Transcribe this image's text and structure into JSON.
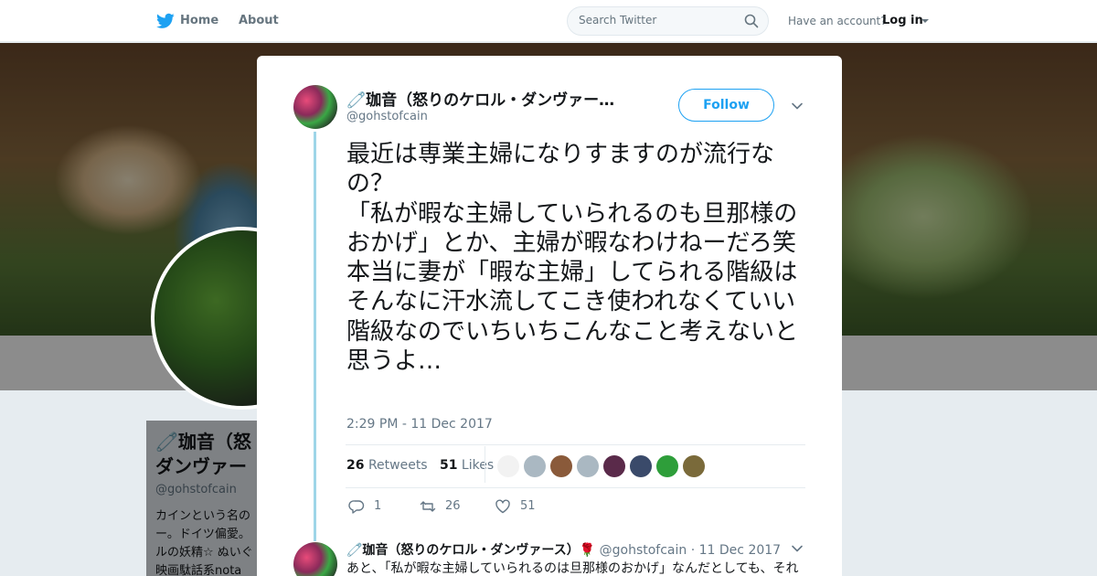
{
  "nav": {
    "home_label": "Home",
    "about_label": "About",
    "search_placeholder": "Search Twitter",
    "have_account": "Have an account?",
    "login_label": "Log in"
  },
  "profile": {
    "name_line1": "🧷珈音（怒",
    "name_line2": "ダンヴァー",
    "handle": "@gohstofcain",
    "bio_line1": "カインという名の",
    "bio_line2": "ー。ドイツ偏愛。",
    "bio_line3": "ルの妖精☆ ぬいぐ",
    "bio_line4": "映画駄話系nota"
  },
  "tweet": {
    "display_name": "🧷珈音（怒りのケロル・ダンヴァー…",
    "screen_name": "@gohstofcain",
    "follow_label": "Follow",
    "text": "最近は専業主婦になりすますのが流行なの？\n「私が暇な主婦していられるのも旦那様のおかげ」とか、主婦が暇なわけねーだろ笑\n本当に妻が「暇な主婦」してられる階級はそんなに汗水流してこき使われなくていい階級なのでいちいちこんなこと考えないと思うよ…",
    "timestamp": "2:29 PM - 11 Dec 2017",
    "retweets_count": "26",
    "retweets_label": "Retweets",
    "likes_count": "51",
    "likes_label": "Likes",
    "liker_colors": [
      "#f2f2f2",
      "#aab8c2",
      "#8a5a3a",
      "#aab8c2",
      "#5a2a4a",
      "#3a4a6a",
      "#2e9e3a",
      "#7a6a3a"
    ],
    "reply_count": "1",
    "retweet_count": "26",
    "like_count": "51"
  },
  "reply": {
    "display_name": "🧷珈音（怒りのケロル・ダンヴァース）🌹",
    "screen_name": "@gohstofcain",
    "date": "· 11 Dec 2017",
    "text": "あと、「私が暇な主婦していられるのは旦那様のおかげ」なんだとしても、それ"
  }
}
